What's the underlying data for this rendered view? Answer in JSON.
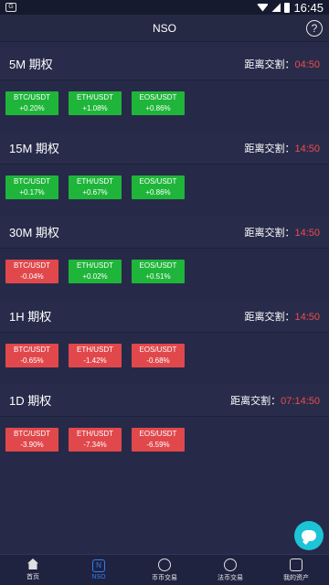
{
  "status_bar": {
    "time": "16:45"
  },
  "header": {
    "title": "NSO",
    "help_label": "?"
  },
  "colors": {
    "up": "#1fb53a",
    "down": "#e0484c",
    "countdown": "#f04a4a",
    "accent": "#2e7ef7"
  },
  "sections": [
    {
      "title": "5M 期权",
      "countdown_label": "距离交割：",
      "countdown_time": "04:50",
      "pairs": [
        {
          "name": "BTC/USDT",
          "change": "+0.20%",
          "direction": "up"
        },
        {
          "name": "ETH/USDT",
          "change": "+1.08%",
          "direction": "up"
        },
        {
          "name": "EOS/USDT",
          "change": "+0.86%",
          "direction": "up"
        }
      ]
    },
    {
      "title": "15M 期权",
      "countdown_label": "距离交割：",
      "countdown_time": "14:50",
      "pairs": [
        {
          "name": "BTC/USDT",
          "change": "+0.17%",
          "direction": "up"
        },
        {
          "name": "ETH/USDT",
          "change": "+0.67%",
          "direction": "up"
        },
        {
          "name": "EOS/USDT",
          "change": "+0.86%",
          "direction": "up"
        }
      ]
    },
    {
      "title": "30M 期权",
      "countdown_label": "距离交割：",
      "countdown_time": "14:50",
      "pairs": [
        {
          "name": "BTC/USDT",
          "change": "-0.04%",
          "direction": "down"
        },
        {
          "name": "ETH/USDT",
          "change": "+0.02%",
          "direction": "up"
        },
        {
          "name": "EOS/USDT",
          "change": "+0.51%",
          "direction": "up"
        }
      ]
    },
    {
      "title": "1H 期权",
      "countdown_label": "距离交割：",
      "countdown_time": "14:50",
      "pairs": [
        {
          "name": "BTC/USDT",
          "change": "-0.65%",
          "direction": "down"
        },
        {
          "name": "ETH/USDT",
          "change": "-1.42%",
          "direction": "down"
        },
        {
          "name": "EOS/USDT",
          "change": "-0.68%",
          "direction": "down"
        }
      ]
    },
    {
      "title": "1D 期权",
      "countdown_label": "距离交割：",
      "countdown_time": "07:14:50",
      "pairs": [
        {
          "name": "BTC/USDT",
          "change": "-3.90%",
          "direction": "down"
        },
        {
          "name": "ETH/USDT",
          "change": "-7.34%",
          "direction": "down"
        },
        {
          "name": "EOS/USDT",
          "change": "-6.59%",
          "direction": "down"
        }
      ]
    }
  ],
  "bottom_nav": [
    {
      "label": "首页",
      "icon": "home-icon",
      "active": false
    },
    {
      "label": "NSO",
      "icon": "nso-icon",
      "active": true
    },
    {
      "label": "币币交易",
      "icon": "coin-exchange-icon",
      "active": false
    },
    {
      "label": "法币交易",
      "icon": "fiat-exchange-icon",
      "active": false
    },
    {
      "label": "我的资产",
      "icon": "wallet-icon",
      "active": false
    }
  ]
}
